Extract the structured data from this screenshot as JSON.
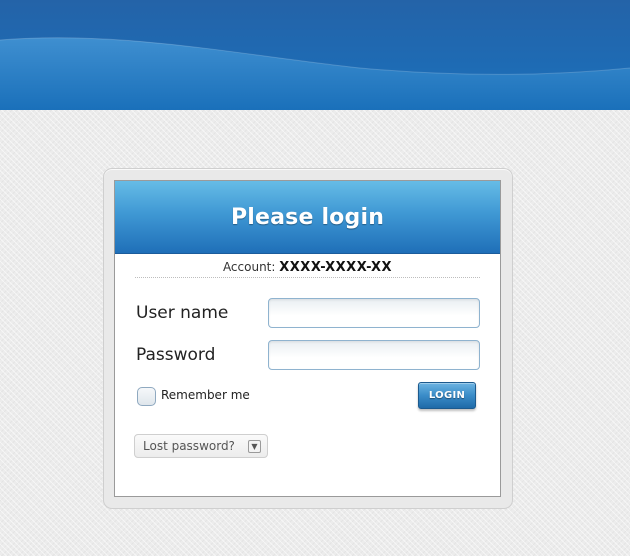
{
  "panel": {
    "title": "Please login",
    "account_label": "Account:",
    "account_value": "XXXX-XXXX-XX"
  },
  "form": {
    "username_label": "User name",
    "username_value": "",
    "password_label": "Password",
    "password_value": "",
    "remember_label": "Remember me",
    "remember_checked": false,
    "login_button": "LOGIN",
    "lost_password": "Lost password?"
  },
  "icons": {
    "lost_password_dropdown": "chevron-down-icon"
  },
  "colors": {
    "banner": "#1e6bb4",
    "header_top": "#66bce6",
    "header_bottom": "#1f6fb8",
    "button": "#3a8cc8"
  }
}
